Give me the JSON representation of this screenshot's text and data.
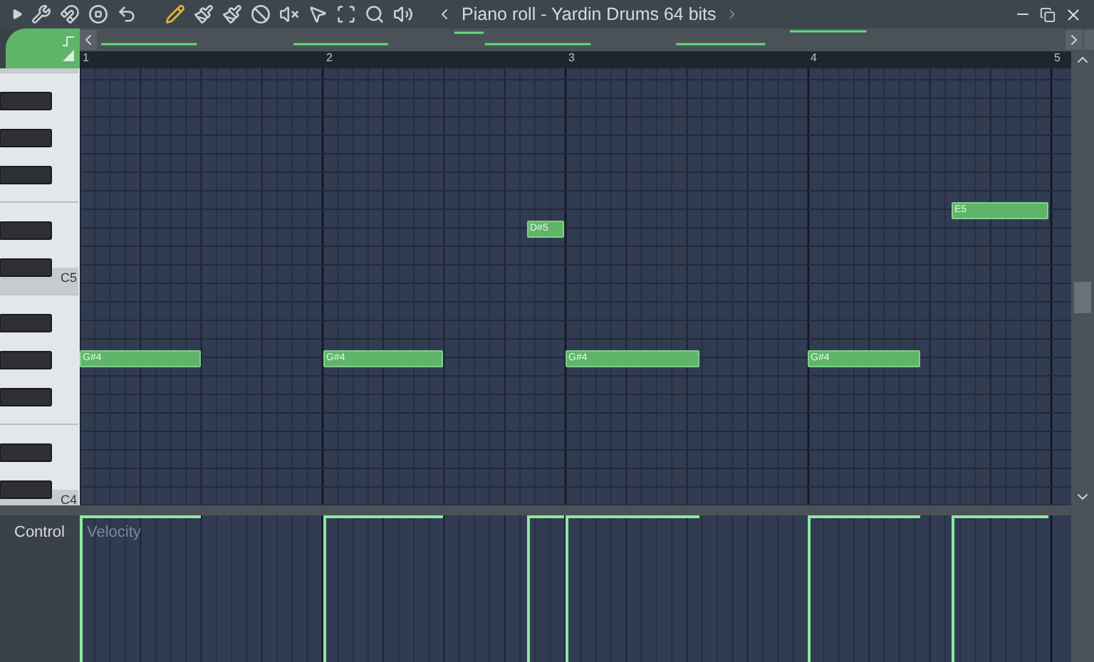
{
  "window": {
    "title": "Piano roll - Yardin Drums 64 bits"
  },
  "ruler": [
    "1",
    "2",
    "3",
    "4",
    "5"
  ],
  "keyboard": {
    "labels": [
      "C5",
      "C4"
    ]
  },
  "notes": [
    {
      "label": "G#4"
    },
    {
      "label": "G#4"
    },
    {
      "label": "D#5"
    },
    {
      "label": "G#4"
    },
    {
      "label": "G#4"
    },
    {
      "label": "E5"
    }
  ],
  "event_editor": {
    "label": "Control",
    "parameter": "Velocity"
  }
}
